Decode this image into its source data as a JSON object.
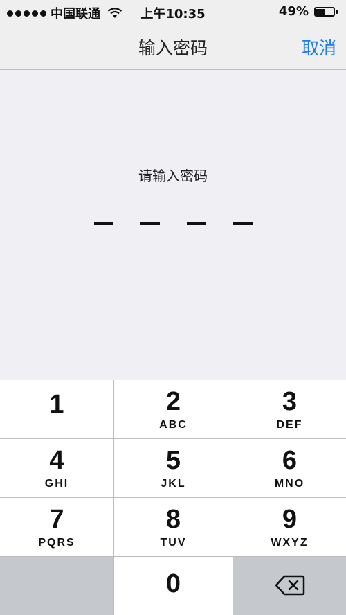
{
  "status_bar": {
    "carrier": "中国联通",
    "time": "上午10:35",
    "battery_percent": "49%",
    "battery_level": 0.49,
    "signal_icon": "signal-dots-icon",
    "wifi_icon": "wifi-icon",
    "battery_icon": "battery-icon"
  },
  "nav": {
    "title": "输入密码",
    "cancel": "取消",
    "accent_color": "#1a7cf4"
  },
  "content": {
    "prompt": "请输入密码",
    "passcode_length": 4
  },
  "keypad": {
    "keys": [
      {
        "num": "1",
        "letters": ""
      },
      {
        "num": "2",
        "letters": "ABC"
      },
      {
        "num": "3",
        "letters": "DEF"
      },
      {
        "num": "4",
        "letters": "GHI"
      },
      {
        "num": "5",
        "letters": "JKL"
      },
      {
        "num": "6",
        "letters": "MNO"
      },
      {
        "num": "7",
        "letters": "PQRS"
      },
      {
        "num": "8",
        "letters": "TUV"
      },
      {
        "num": "9",
        "letters": "WXYZ"
      },
      {
        "num": "0",
        "letters": ""
      }
    ],
    "delete_icon": "backspace-icon"
  }
}
